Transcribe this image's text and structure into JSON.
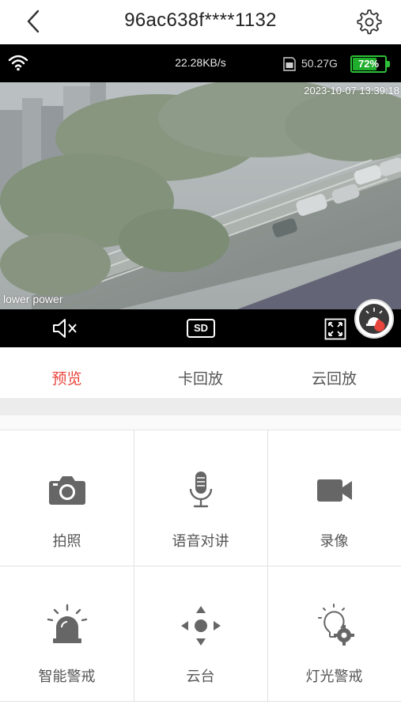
{
  "header": {
    "title": "96ac638f****1132",
    "back_icon": "chevron-left-icon",
    "settings_icon": "gear-icon"
  },
  "video": {
    "status": {
      "wifi_icon": "wifi-icon",
      "rate": "22.28KB/s",
      "sd_icon": "sd-card-icon",
      "storage": "50.27G",
      "battery_label": "72%",
      "battery_level": 0.72
    },
    "timestamp": "2023-10-07 13:39:18",
    "overlay_text": "lower power",
    "controls": {
      "mute_icon": "speaker-mute-icon",
      "quality_label": "SD",
      "fullscreen_icon": "fullscreen-icon",
      "alarm_icon": "alarm-touch-icon"
    }
  },
  "tabs": [
    {
      "label": "预览",
      "active": true
    },
    {
      "label": "卡回放",
      "active": false
    },
    {
      "label": "云回放",
      "active": false
    }
  ],
  "functions": [
    {
      "label": "拍照",
      "icon": "camera-icon"
    },
    {
      "label": "语音对讲",
      "icon": "microphone-icon"
    },
    {
      "label": "录像",
      "icon": "video-camera-icon"
    },
    {
      "label": "智能警戒",
      "icon": "siren-icon"
    },
    {
      "label": "云台",
      "icon": "ptz-direction-icon"
    },
    {
      "label": "灯光警戒",
      "icon": "light-bulb-gear-icon"
    }
  ],
  "colors": {
    "accent": "#e8453c",
    "battery": "#2fbf3a",
    "icon_gray": "#666666"
  }
}
